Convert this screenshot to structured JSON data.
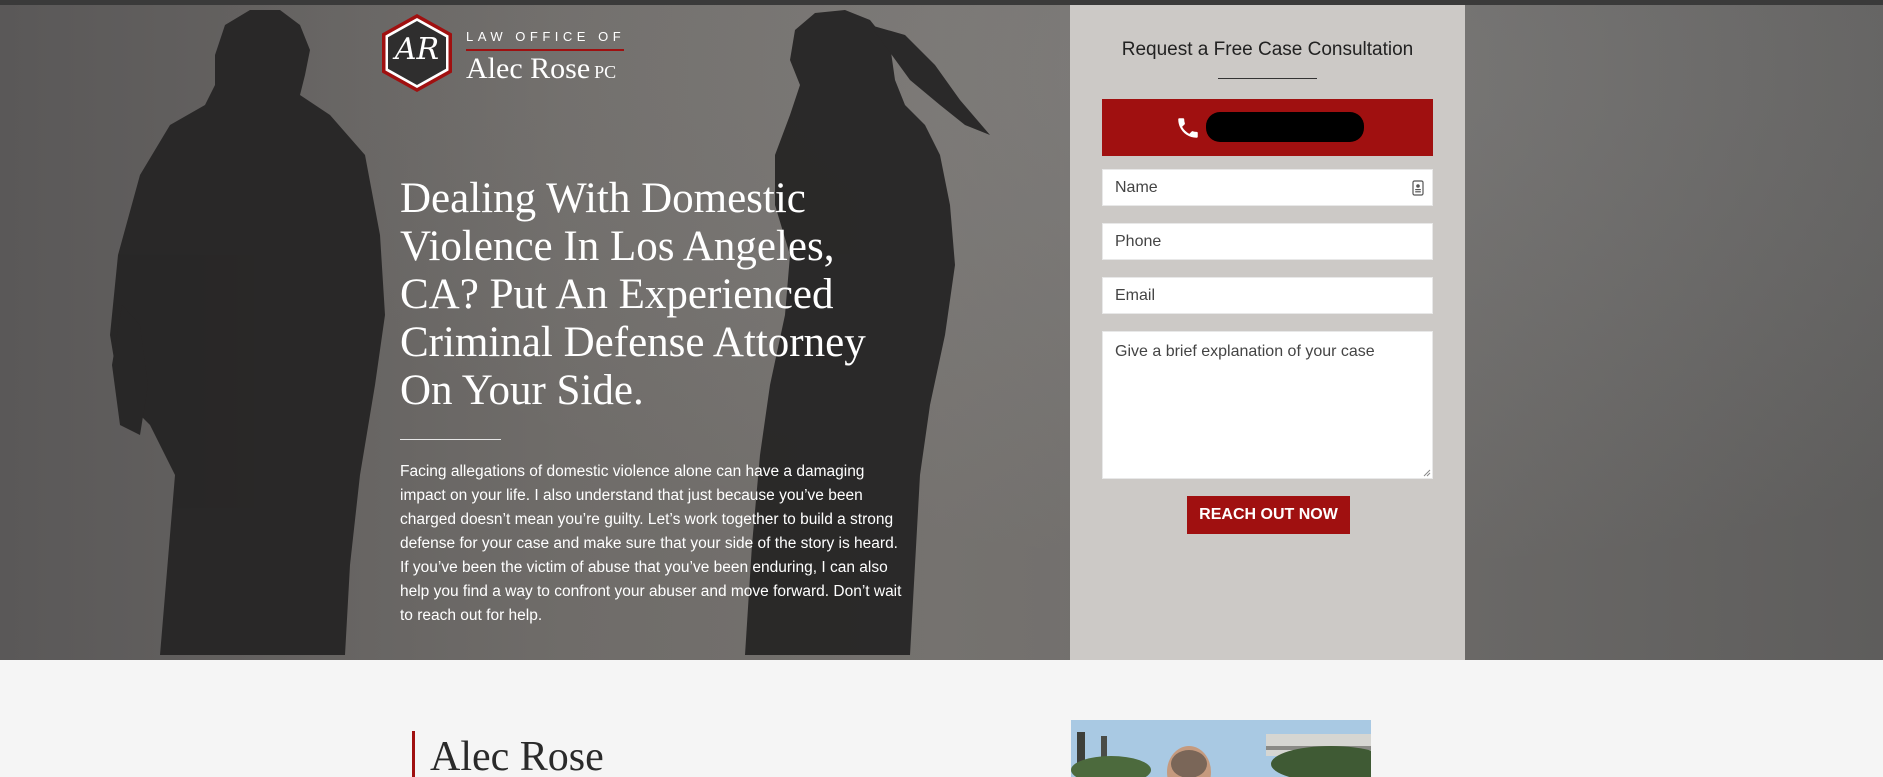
{
  "logo": {
    "monogram": "AR",
    "top_line": "LAW OFFICE OF",
    "name": "Alec Rose",
    "suffix": "PC"
  },
  "hero": {
    "headline": "Dealing With Domestic Violence In Los Angeles, CA? Put An Experienced Criminal Defense Attorney On Your Side.",
    "intro": "Facing allegations of domestic violence alone can have a damaging impact on your life. I also understand that just because you’ve been charged doesn’t mean you’re guilty. Let’s work together to build a strong defense for your case and make sure that your side of the story is heard. If you’ve been the victim of abuse that you’ve been enduring, I can also help you find a way to confront your abuser and move forward. Don’t wait to reach out for help."
  },
  "form": {
    "title": "Request a Free Case Consultation",
    "phone_button": {
      "icon": "phone-icon",
      "number_redacted": true
    },
    "fields": {
      "name_placeholder": "Name",
      "phone_placeholder": "Phone",
      "email_placeholder": "Email",
      "case_placeholder": "Give a brief explanation of your case"
    },
    "submit_label": "REACH OUT NOW"
  },
  "bio": {
    "name": "Alec Rose"
  },
  "colors": {
    "accent_red": "#a01010",
    "form_panel": "#ccc9c6",
    "hero_text": "#ffffff"
  }
}
